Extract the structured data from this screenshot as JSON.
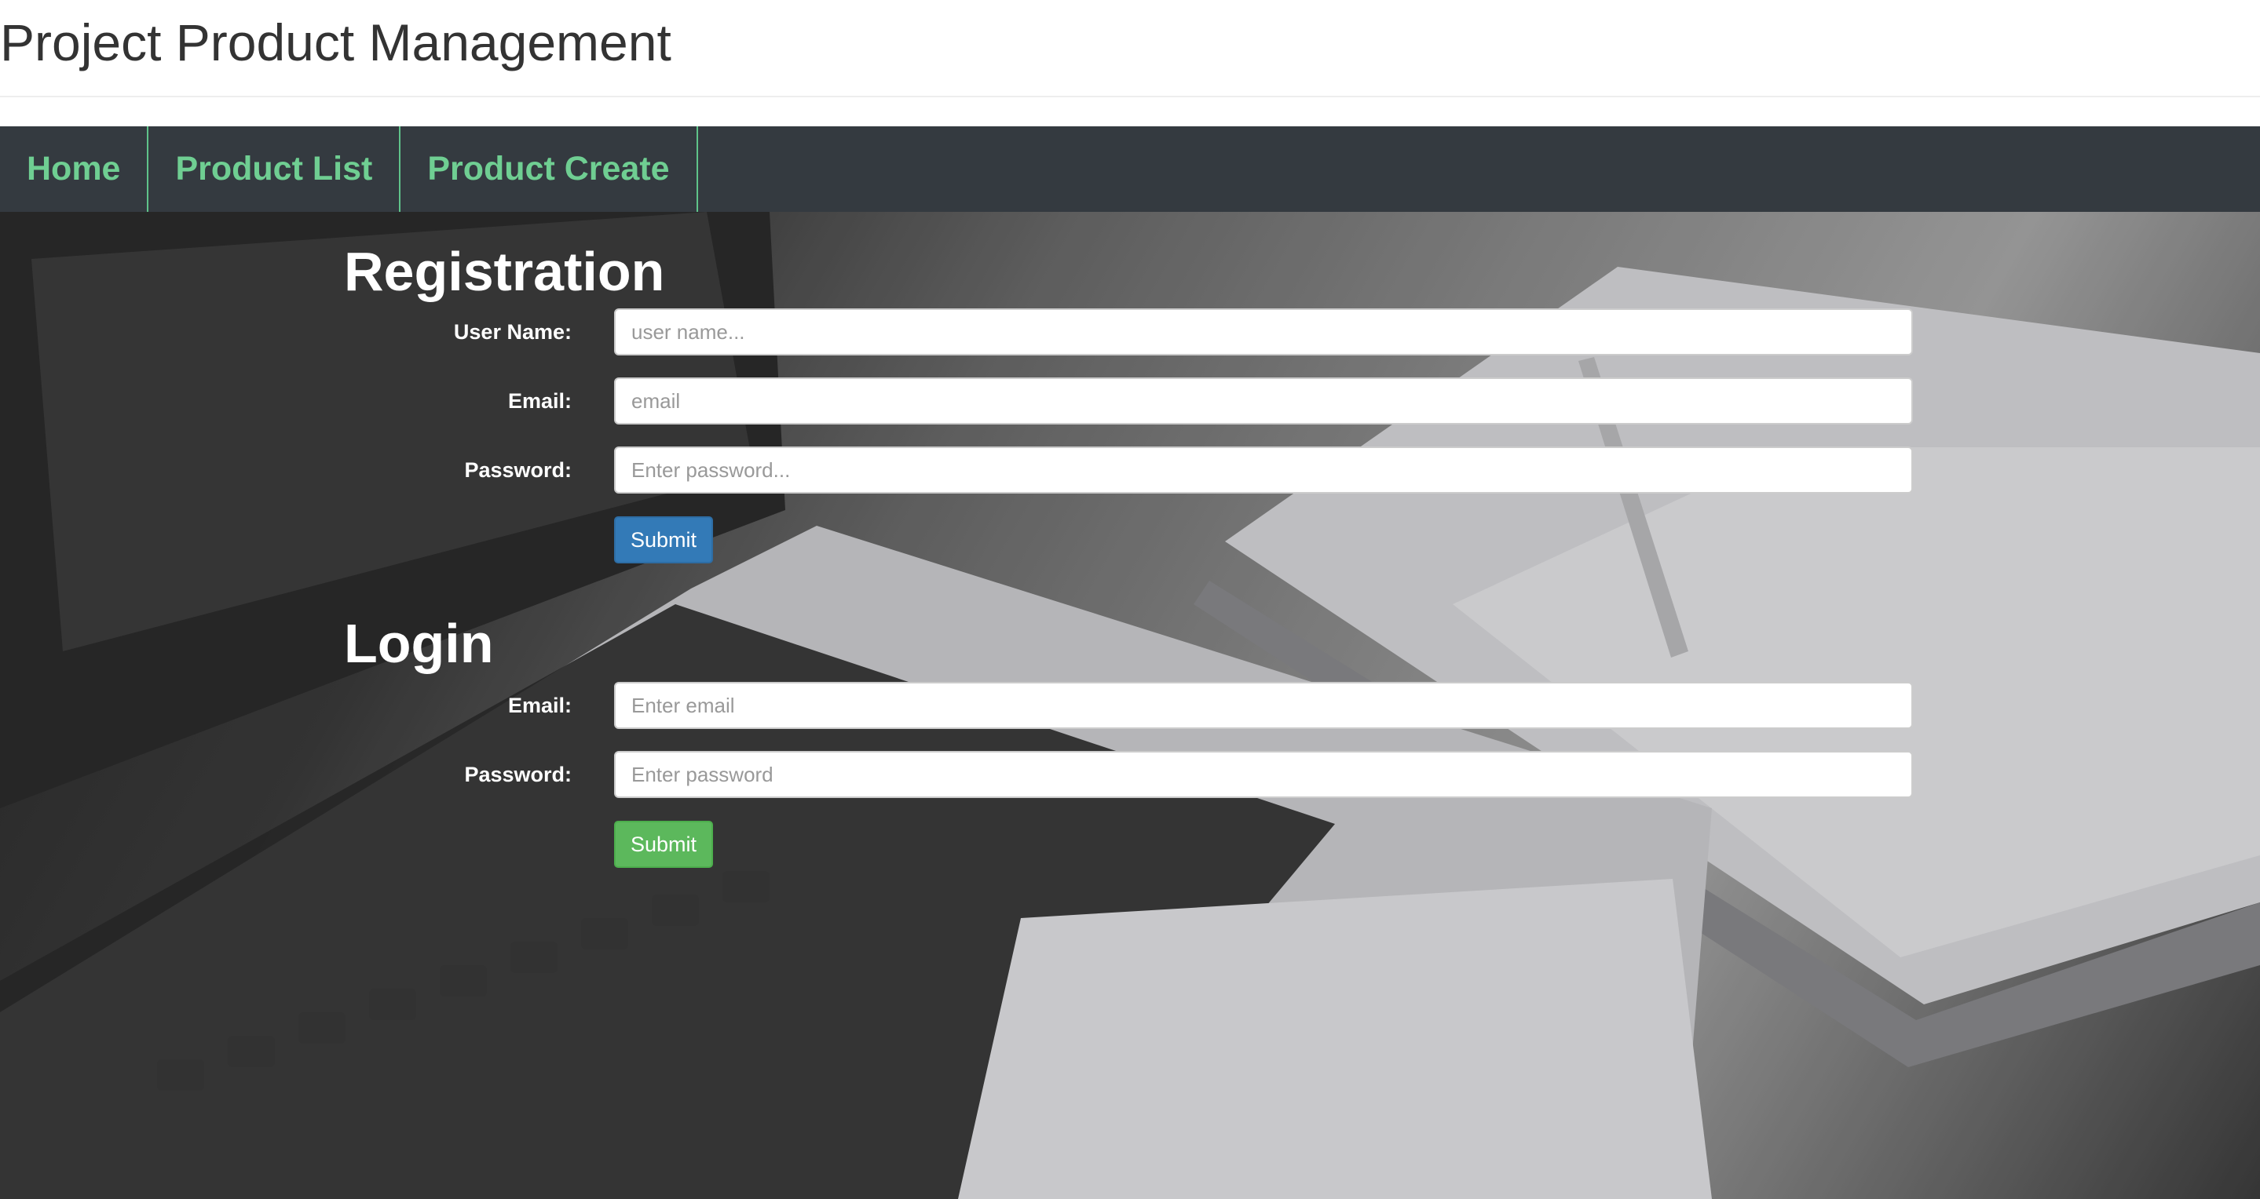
{
  "header": {
    "title": "Project Product Management"
  },
  "nav": {
    "items": [
      {
        "label": "Home"
      },
      {
        "label": "Product List"
      },
      {
        "label": "Product Create"
      }
    ]
  },
  "registration": {
    "heading": "Registration",
    "username_label": "User Name:",
    "username_placeholder": "user name...",
    "email_label": "Email:",
    "email_placeholder": "email",
    "password_label": "Password:",
    "password_placeholder": "Enter password...",
    "submit_label": "Submit"
  },
  "login": {
    "heading": "Login",
    "email_label": "Email:",
    "email_placeholder": "Enter email",
    "password_label": "Password:",
    "password_placeholder": "Enter password",
    "submit_label": "Submit"
  },
  "colors": {
    "navbar_bg": "#343a40",
    "nav_link": "#6fce92",
    "primary_button": "#337ab7",
    "success_button": "#5cb85c"
  }
}
